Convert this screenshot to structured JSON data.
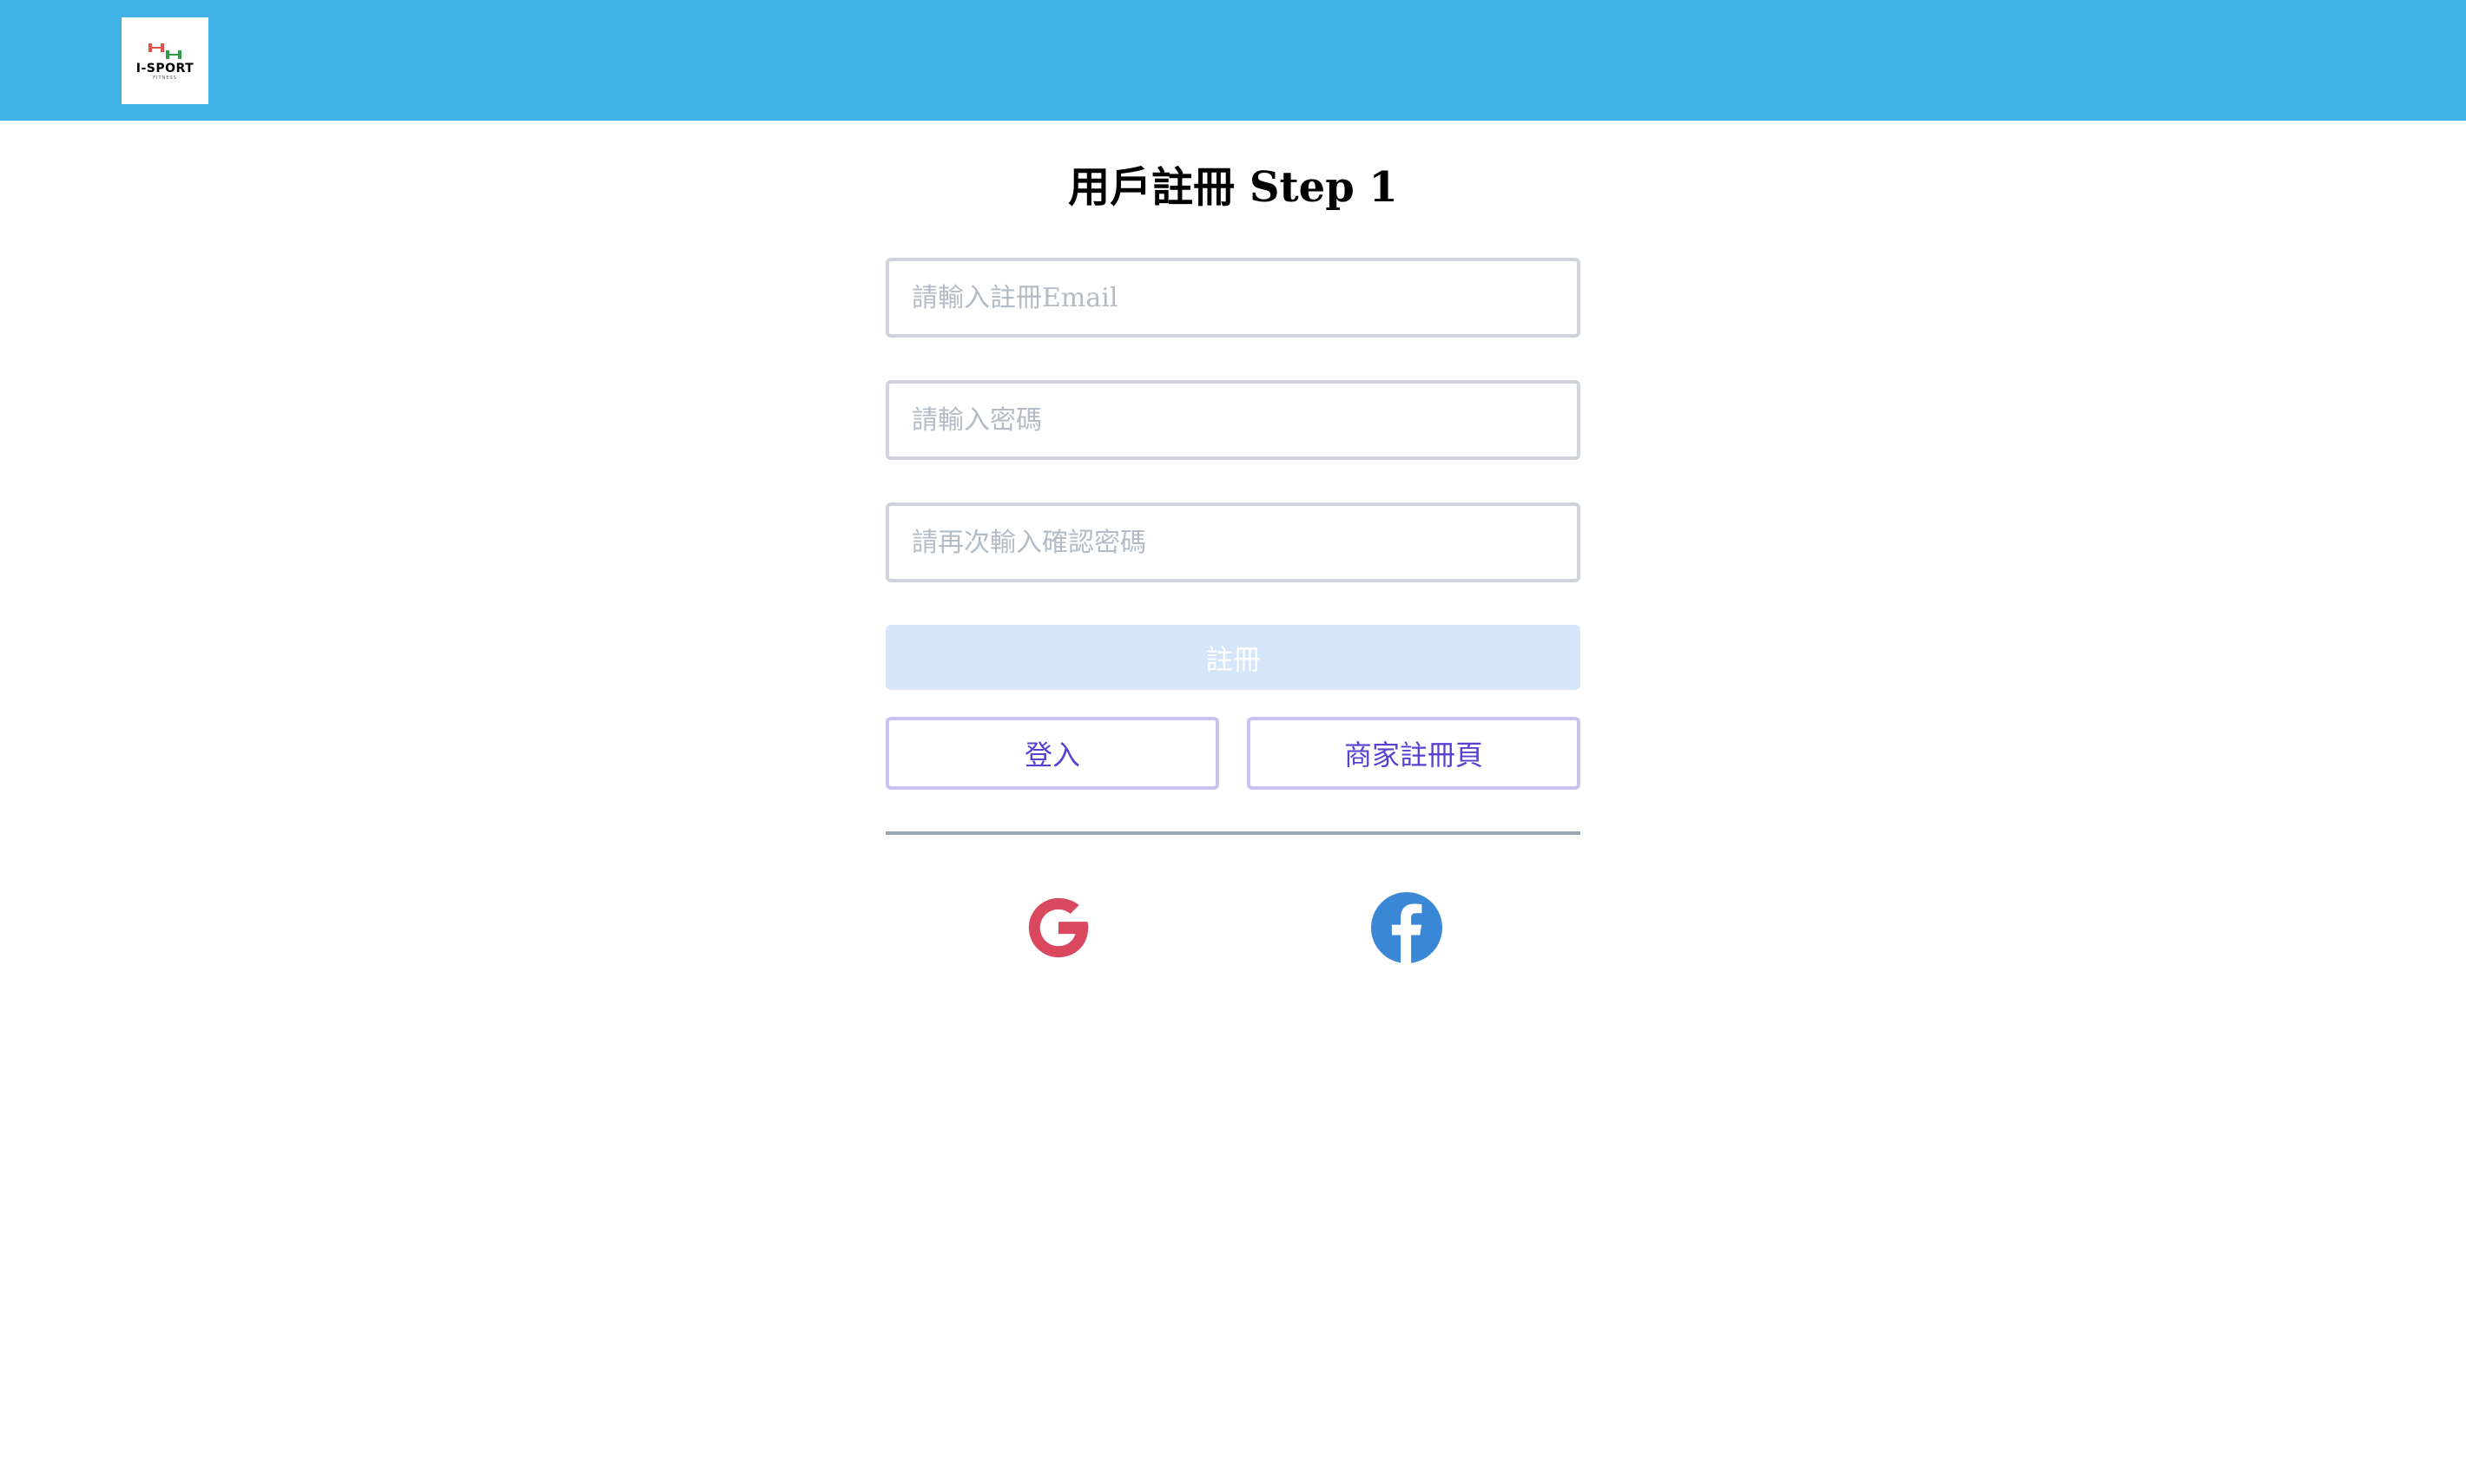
{
  "header": {
    "logo": {
      "text": "I-SPORT",
      "subtext": "FITNESS"
    }
  },
  "form": {
    "title": "用戶註冊 Step 1",
    "email_placeholder": "請輸入註冊Email",
    "password_placeholder": "請輸入密碼",
    "confirm_password_placeholder": "請再次輸入確認密碼",
    "submit_label": "註冊",
    "login_label": "登入",
    "merchant_register_label": "商家註冊頁"
  },
  "social": {
    "google_icon": "google-icon",
    "facebook_icon": "facebook-icon"
  },
  "colors": {
    "header_bg": "#41b2e6",
    "submit_disabled_bg": "#d6e6fa",
    "secondary_border": "#c8c2f2",
    "secondary_text": "#5a3fd1",
    "divider": "#9aa5b1",
    "google": "#d9485f",
    "facebook": "#3a87d6"
  }
}
